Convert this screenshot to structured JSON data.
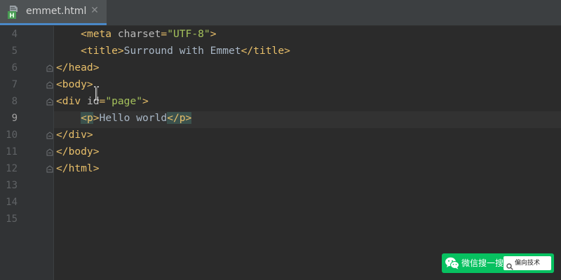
{
  "tab": {
    "file_name": "emmet.html",
    "file_type_icon": "html-file-icon",
    "file_type_letter": "H",
    "close_glyph": "✕",
    "active_underline_color": "#4a88c7"
  },
  "gutter": {
    "line_numbers": [
      "4",
      "5",
      "6",
      "7",
      "8",
      "9",
      "10",
      "11",
      "12",
      "13",
      "14",
      "15"
    ],
    "current_line": "9"
  },
  "code": {
    "lines": [
      [
        {
          "t": "    "
        },
        {
          "c": "tag",
          "t": "<meta "
        },
        {
          "c": "attr",
          "t": "charset"
        },
        {
          "c": "tag",
          "t": "="
        },
        {
          "c": "str",
          "t": "\"UTF-8\""
        },
        {
          "c": "tag",
          "t": ">"
        }
      ],
      [
        {
          "t": "    "
        },
        {
          "c": "tag",
          "t": "<title>"
        },
        {
          "c": "txt",
          "t": "Surround with Emmet"
        },
        {
          "c": "tag",
          "t": "</title>"
        }
      ],
      [
        {
          "c": "tag",
          "t": "</head>"
        }
      ],
      [
        {
          "c": "tag",
          "t": "<body>"
        }
      ],
      [
        {
          "c": "tag",
          "t": "<div "
        },
        {
          "c": "attr",
          "t": "id"
        },
        {
          "c": "tag",
          "t": "="
        },
        {
          "c": "str",
          "t": "\"page\""
        },
        {
          "c": "tag",
          "t": ">"
        }
      ],
      [
        {
          "t": "    "
        },
        {
          "c": "tag match",
          "t": "<p"
        },
        {
          "c": "tag",
          "t": ">"
        },
        {
          "c": "txt",
          "t": "Hello world"
        },
        {
          "c": "tag match",
          "t": "</p>"
        }
      ],
      [
        {
          "c": "tag",
          "t": "</div>"
        }
      ],
      [
        {
          "c": "tag",
          "t": "</body>"
        }
      ],
      [
        {
          "c": "tag",
          "t": "</html>"
        }
      ],
      [],
      [],
      []
    ],
    "fold_marker_lines": [
      "6",
      "7",
      "8",
      "10",
      "11",
      "12"
    ],
    "colors": {
      "tag": "#e8bf6a",
      "attribute": "#bababa",
      "string": "#a5c25c",
      "text": "#a9b7c6",
      "background": "#2b2b2b",
      "current_line_background": "#323232",
      "matched_tag_background": "#3b514d"
    }
  },
  "watermark": {
    "icon": "wechat-icon",
    "label": "微信搜一搜",
    "search_icon": "magnifier-icon",
    "query": "偏向技术",
    "color": "#07c160"
  }
}
